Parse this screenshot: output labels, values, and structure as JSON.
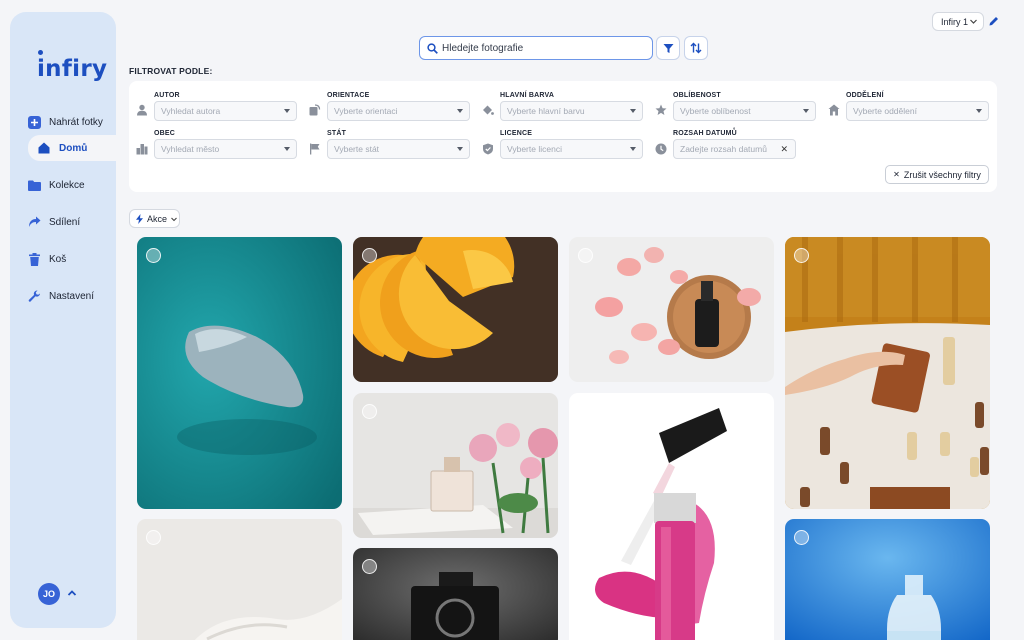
{
  "app": {
    "logo_text": "infiry",
    "account": "Infiry 1"
  },
  "sidebar": {
    "items": [
      {
        "label": "Nahrát fotky",
        "icon": "upload-plus-icon"
      },
      {
        "label": "Domů",
        "icon": "home-icon",
        "active": true
      },
      {
        "label": "Kolekce",
        "icon": "folder-icon"
      },
      {
        "label": "Sdílení",
        "icon": "share-icon"
      },
      {
        "label": "Koš",
        "icon": "trash-icon"
      },
      {
        "label": "Nastavení",
        "icon": "wrench-icon"
      }
    ],
    "user_initials": "JO"
  },
  "search": {
    "placeholder": "Hledejte fotografie",
    "value": ""
  },
  "filters": {
    "title": "FILTROVAT PODLE:",
    "fields": [
      {
        "label": "AUTOR",
        "placeholder": "Vyhledat autora",
        "icon": "person-icon"
      },
      {
        "label": "ORIENTACE",
        "placeholder": "Vyberte orientaci",
        "icon": "orientation-icon"
      },
      {
        "label": "HLAVNÍ BARVA",
        "placeholder": "Vyberte hlavní barvu",
        "icon": "paint-bucket-icon"
      },
      {
        "label": "OBLÍBENOST",
        "placeholder": "Vyberte oblíbenost",
        "icon": "star-icon"
      },
      {
        "label": "ODDĚLENÍ",
        "placeholder": "Vyberte oddělení",
        "icon": "building-icon"
      },
      {
        "label": "OBEC",
        "placeholder": "Vyhledat město",
        "icon": "city-icon"
      },
      {
        "label": "STÁT",
        "placeholder": "Vyberte stát",
        "icon": "flag-icon"
      },
      {
        "label": "LICENCE",
        "placeholder": "Vyberte licenci",
        "icon": "shield-icon"
      },
      {
        "label": "ROZSAH DATUMŮ",
        "placeholder": "Zadejte rozsah datumů",
        "icon": "clock-icon"
      }
    ],
    "clear_all": "Zrušit všechny filtry"
  },
  "actions": {
    "label": "Akce"
  },
  "gallery": {
    "photos": [
      {
        "name": "guitar-pick",
        "colors": [
          "#0f7f86",
          "#1b9aa2"
        ]
      },
      {
        "name": "orange-slices",
        "colors": [
          "#3b2a22",
          "#f0a020"
        ]
      },
      {
        "name": "serum-roses",
        "colors": [
          "#ececec",
          "#f3a8a8"
        ]
      },
      {
        "name": "wallet-chess",
        "colors": [
          "#c8871c",
          "#ede7df"
        ]
      },
      {
        "name": "perfume-flowers",
        "colors": [
          "#e4e4e2",
          "#e59bb0"
        ]
      },
      {
        "name": "venus-lipgloss",
        "colors": [
          "#ffffff",
          "#d6307f"
        ]
      },
      {
        "name": "white-fabric",
        "colors": [
          "#e8e6e3",
          "#f3f1ee"
        ]
      },
      {
        "name": "black-perfume",
        "colors": [
          "#4f4f4f",
          "#1a1a1a"
        ]
      },
      {
        "name": "glass-bottle",
        "colors": [
          "#1770d0",
          "#53a6e8"
        ]
      }
    ]
  },
  "colors": {
    "accent": "#1d4fc0",
    "sidebar_bg": "#d9e6f7",
    "page_bg": "#f4f5f8"
  }
}
